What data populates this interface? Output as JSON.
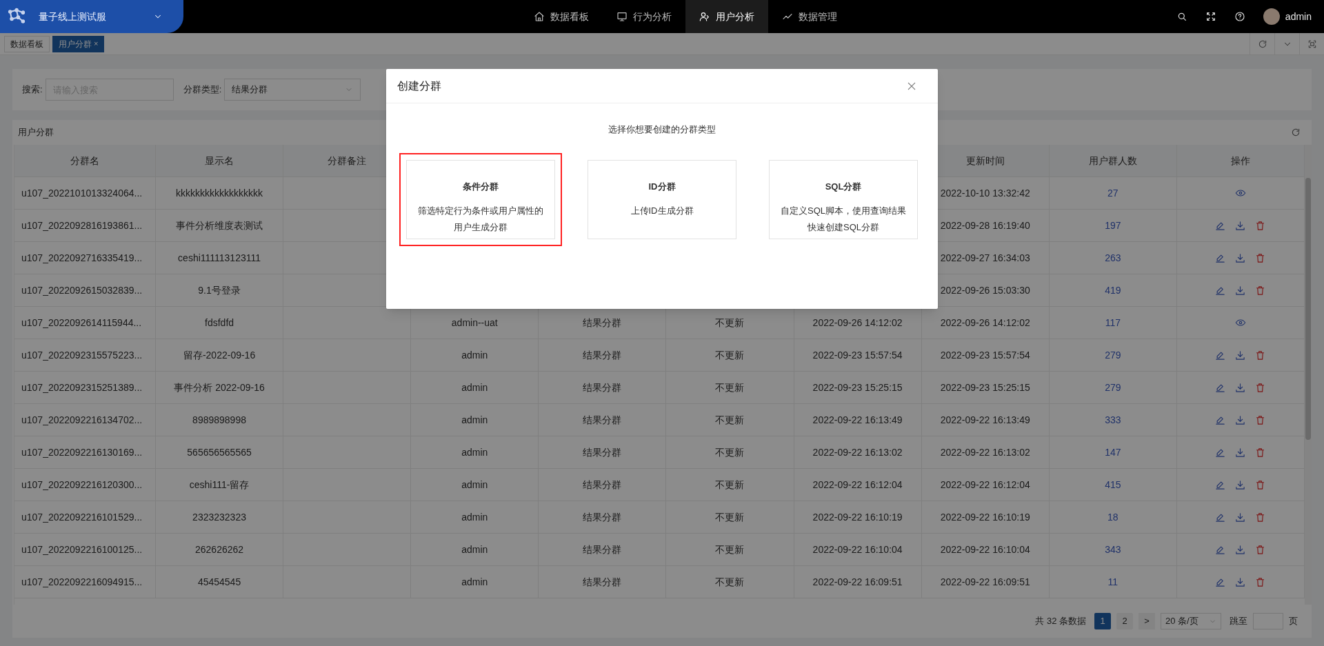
{
  "top_bar": {
    "project": "量子线上测试服",
    "nav": [
      {
        "label": "数据看板",
        "kind": "home",
        "selected": false
      },
      {
        "label": "行为分析",
        "kind": "monitor",
        "selected": false
      },
      {
        "label": "用户分析",
        "kind": "user",
        "selected": true
      },
      {
        "label": "数据管理",
        "kind": "trend",
        "selected": false
      }
    ],
    "user": "admin"
  },
  "tabs": [
    {
      "label": "数据看板",
      "selected": false
    },
    {
      "label": "用户分群",
      "selected": true,
      "close": "×"
    }
  ],
  "filters": {
    "search_label": "搜索:",
    "search_placeholder": "请输入搜索",
    "type_label": "分群类型:",
    "type_value": "结果分群"
  },
  "table": {
    "title": "用户分群",
    "columns": [
      {
        "label": "分群名"
      },
      {
        "label": "显示名"
      },
      {
        "label": "分群备注"
      },
      {},
      {},
      {},
      {},
      {
        "label": "更新时间"
      },
      {
        "label": "用户群人数"
      },
      {
        "label": "操作"
      }
    ],
    "rows": [
      {
        "name": "u107_2022101013324064...",
        "display": "kkkkkkkkkkkkkkkkkk",
        "updated": "2022-10-10 13:32:42",
        "count": "27",
        "kind": "view"
      },
      {
        "name": "u107_2022092816193861...",
        "display": "事件分析维度表测试",
        "updated": "2022-09-28 16:19:40",
        "count": "197",
        "kind": "manage"
      },
      {
        "name": "u107_2022092716335419...",
        "display": "ceshi111113123111",
        "updated": "2022-09-27 16:34:03",
        "count": "263",
        "kind": "manage"
      },
      {
        "name": "u107_2022092615032839...",
        "display": "9.1号登录",
        "updated": "2022-09-26 15:03:30",
        "count": "419",
        "kind": "manage"
      },
      {
        "name": "u107_2022092614115944...",
        "display": "fdsfdfd",
        "creator": "admin--uat",
        "type": "结果分群",
        "status": "不更新",
        "created": "2022-09-26 14:12:02",
        "updated": "2022-09-26 14:12:02",
        "count": "117",
        "kind": "view"
      },
      {
        "name": "u107_2022092315575223...",
        "display": "留存-2022-09-16",
        "creator": "admin",
        "type": "结果分群",
        "status": "不更新",
        "created": "2022-09-23 15:57:54",
        "updated": "2022-09-23 15:57:54",
        "count": "279",
        "kind": "manage"
      },
      {
        "name": "u107_2022092315251389...",
        "display": "事件分析 2022-09-16",
        "creator": "admin",
        "type": "结果分群",
        "status": "不更新",
        "created": "2022-09-23 15:25:15",
        "updated": "2022-09-23 15:25:15",
        "count": "279",
        "kind": "manage"
      },
      {
        "name": "u107_2022092216134702...",
        "display": "8989898998",
        "creator": "admin",
        "type": "结果分群",
        "status": "不更新",
        "created": "2022-09-22 16:13:49",
        "updated": "2022-09-22 16:13:49",
        "count": "333",
        "kind": "manage"
      },
      {
        "name": "u107_2022092216130169...",
        "display": "565656565565",
        "creator": "admin",
        "type": "结果分群",
        "status": "不更新",
        "created": "2022-09-22 16:13:02",
        "updated": "2022-09-22 16:13:02",
        "count": "147",
        "kind": "manage"
      },
      {
        "name": "u107_2022092216120300...",
        "display": "ceshi111-留存",
        "creator": "admin",
        "type": "结果分群",
        "status": "不更新",
        "created": "2022-09-22 16:12:04",
        "updated": "2022-09-22 16:12:04",
        "count": "415",
        "kind": "manage"
      },
      {
        "name": "u107_2022092216101529...",
        "display": "2323232323",
        "creator": "admin",
        "type": "结果分群",
        "status": "不更新",
        "created": "2022-09-22 16:10:19",
        "updated": "2022-09-22 16:10:19",
        "count": "18",
        "kind": "manage"
      },
      {
        "name": "u107_2022092216100125...",
        "display": "262626262",
        "creator": "admin",
        "type": "结果分群",
        "status": "不更新",
        "created": "2022-09-22 16:10:04",
        "updated": "2022-09-22 16:10:04",
        "count": "343",
        "kind": "manage"
      },
      {
        "name": "u107_2022092216094915...",
        "display": "45454545",
        "creator": "admin",
        "type": "结果分群",
        "status": "不更新",
        "created": "2022-09-22 16:09:51",
        "updated": "2022-09-22 16:09:51",
        "count": "11",
        "kind": "manage"
      }
    ]
  },
  "pagination": {
    "total": "共 32 条数据",
    "pages": [
      {
        "label": "1",
        "selected": true
      },
      {
        "label": "2",
        "selected": false
      }
    ],
    "next": ">",
    "page_size": "20 条/页",
    "jump_label": "跳至",
    "jump_suffix": "页"
  },
  "modal": {
    "title": "创建分群",
    "subtitle": "选择你想要创建的分群类型",
    "options": [
      {
        "title": "条件分群",
        "description": "筛选特定行为条件或用户属性的用户生成分群",
        "selected": true
      },
      {
        "title": "ID分群",
        "description": "上传ID生成分群",
        "selected": false
      },
      {
        "title": "SQL分群",
        "description": "自定义SQL脚本，使用查询结果快速创建SQL分群",
        "selected": false
      }
    ]
  }
}
